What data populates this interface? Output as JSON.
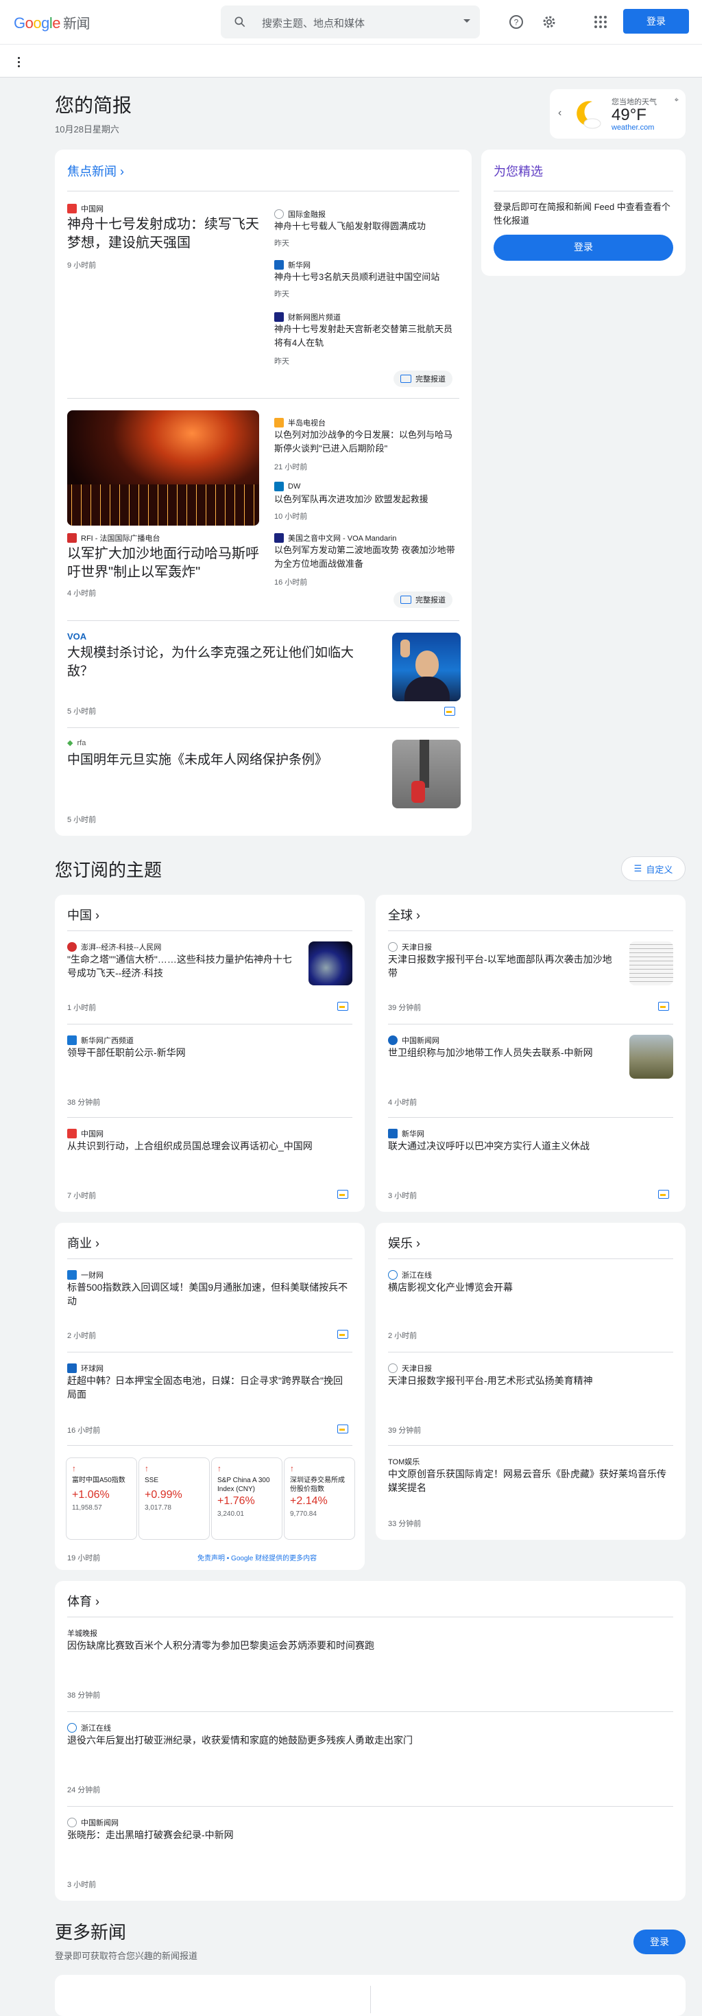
{
  "header": {
    "logo_google": "Google",
    "logo_news": "新闻",
    "search_placeholder": "搜索主题、地点和媒体",
    "login": "登录"
  },
  "briefing": {
    "title": "您的简报",
    "date": "10月28日星期六"
  },
  "weather": {
    "label": "您当地的天气",
    "temp": "49°F",
    "source": "weather.com"
  },
  "top": {
    "title": "焦点新闻",
    "story1": {
      "main": {
        "source": "中国网",
        "headline": "神舟十七号发射成功：续写飞天梦想，建设航天强国",
        "time": "9 小时前"
      },
      "side": [
        {
          "source": "国际金融报",
          "headline": "神舟十七号载人飞船发射取得圆满成功",
          "time": "昨天"
        },
        {
          "source": "新华网",
          "headline": "神舟十七号3名航天员顺利进驻中国空间站",
          "time": "昨天"
        },
        {
          "source": "财新网图片频道",
          "headline": "神舟十七号发射赴天宫新老交替第三批航天员将有4人在轨",
          "time": "昨天"
        }
      ],
      "full": "完整报道"
    },
    "story2": {
      "main": {
        "source": "RFI - 法国国际广播电台",
        "headline": "以军扩大加沙地面行动哈马斯呼吁世界\"制止以军轰炸\"",
        "time": "4 小时前"
      },
      "side": [
        {
          "source": "半岛电视台",
          "headline": "以色列对加沙战争的今日发展：以色列与哈马斯停火谈判\"已进入后期阶段\"",
          "time": "21 小时前"
        },
        {
          "source": "DW",
          "headline": "以色列军队再次进攻加沙 欧盟发起救援",
          "time": "10 小时前"
        },
        {
          "source": "美国之音中文网 - VOA Mandarin",
          "headline": "以色列军方发动第二波地面攻势 夜袭加沙地带 为全方位地面战做准备",
          "time": "16 小时前"
        }
      ],
      "full": "完整报道"
    },
    "story3": {
      "source": "VOA",
      "headline": "大规模封杀讨论，为什么李克强之死让他们如临大敌？",
      "time": "5 小时前"
    },
    "story4": {
      "source": "rfa",
      "headline": "中国明年元旦实施《未成年人网络保护条例》",
      "time": "5 小时前"
    }
  },
  "foryou": {
    "title": "为您精选",
    "text": "登录后即可在简报和新闻 Feed 中查看查看个性化报道",
    "login": "登录"
  },
  "topics": {
    "title": "您订阅的主题",
    "customize": "自定义"
  },
  "china": {
    "title": "中国",
    "items": [
      {
        "source": "澎湃--经济-科技--人民网",
        "headline": "\"生命之塔\"\"通信大桥\"……这些科技力量护佑神舟十七号成功飞天--经济·科技",
        "time": "1 小时前"
      },
      {
        "source": "新华网广西频道",
        "headline": "领导干部任职前公示-新华网",
        "time": "38 分钟前"
      },
      {
        "source": "中国网",
        "headline": "从共识到行动，上合组织成员国总理会议再话初心_中国网",
        "time": "7 小时前"
      }
    ]
  },
  "world": {
    "title": "全球",
    "items": [
      {
        "source": "天津日报",
        "headline": "天津日报数字报刊平台-以军地面部队再次袭击加沙地带",
        "time": "39 分钟前"
      },
      {
        "source": "中国新闻网",
        "headline": "世卫组织称与加沙地带工作人员失去联系-中新网",
        "time": "4 小时前"
      },
      {
        "source": "新华网",
        "headline": "联大通过决议呼吁以巴冲突方实行人道主义休战",
        "time": "3 小时前"
      }
    ]
  },
  "business": {
    "title": "商业",
    "items": [
      {
        "source": "一财网",
        "headline": "标普500指数跌入回调区域！美国9月通胀加速，但科美联储按兵不动",
        "time": "2 小时前"
      },
      {
        "source": "环球网",
        "headline": "赶超中韩？日本押宝全固态电池，日媒：日企寻求\"跨界联合\"挽回局面",
        "time": "16 小时前"
      }
    ],
    "stocks": [
      {
        "name": "富时中国A50指数",
        "pct": "+1.06%",
        "val": "11,958.57"
      },
      {
        "name": "SSE",
        "pct": "+0.99%",
        "val": "3,017.78"
      },
      {
        "name": "S&P China A 300 Index (CNY)",
        "pct": "+1.76%",
        "val": "3,240.01"
      },
      {
        "name": "深圳证券交易所成份股价指数",
        "pct": "+2.14%",
        "val": "9,770.84"
      }
    ],
    "stocks_time": "19 小时前",
    "disclaimer": "免责声明 • Google 财经提供的更多内容"
  },
  "ent": {
    "title": "娱乐",
    "items": [
      {
        "source": "浙江在线",
        "headline": "横店影视文化产业博览会开幕",
        "time": "2 小时前"
      },
      {
        "source": "天津日报",
        "headline": "天津日报数字报刊平台-用艺术形式弘扬美育精神",
        "time": "39 分钟前"
      },
      {
        "source": "TOM娱乐",
        "headline": "中文原创音乐获国际肯定！网易云音乐《卧虎藏》获好莱坞音乐传媒奖提名",
        "time": "33 分钟前"
      }
    ]
  },
  "sports": {
    "title": "体育",
    "items": [
      {
        "source": "羊城晚报",
        "headline": "因伤缺席比赛致百米个人积分清零为参加巴黎奥运会苏炳添要和时间赛跑",
        "time": "38 分钟前"
      },
      {
        "source": "浙江在线",
        "headline": "退役六年后复出打破亚洲纪录，收获爱情和家庭的她鼓励更多残疾人勇敢走出家门",
        "time": "24 分钟前"
      },
      {
        "source": "中国新闻网",
        "headline": "张晓彤：走出黑暗打破赛会纪录-中新网",
        "time": "3 小时前"
      }
    ]
  },
  "more": {
    "title": "更多新闻",
    "sub": "登录即可获取符合您兴趣的新闻报道",
    "login": "登录"
  }
}
